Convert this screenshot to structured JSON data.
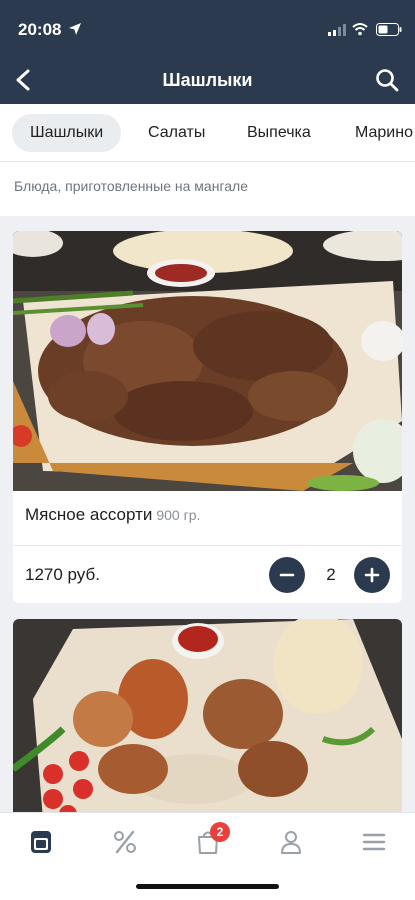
{
  "status_bar": {
    "time": "20:08"
  },
  "header": {
    "title": "Шашлыки"
  },
  "tabs": [
    {
      "label": "Шашлыки",
      "active": true
    },
    {
      "label": "Салаты",
      "active": false
    },
    {
      "label": "Выпечка",
      "active": false
    },
    {
      "label": "Марино",
      "active": false
    }
  ],
  "category_description": "Блюда, приготовленные на мангале",
  "products": [
    {
      "name": "Мясное ассорти",
      "weight": "900 гр.",
      "price": "1270 руб.",
      "quantity": "2"
    }
  ],
  "tabbar": {
    "cart_badge": "2",
    "items": [
      "menu-icon",
      "discount-icon",
      "cart-icon",
      "profile-icon",
      "burger-icon"
    ]
  },
  "colors": {
    "header_bg": "#2b3a4f",
    "accent": "#2b3a4f",
    "badge": "#e8413b",
    "page_bg": "#eef0f3"
  }
}
